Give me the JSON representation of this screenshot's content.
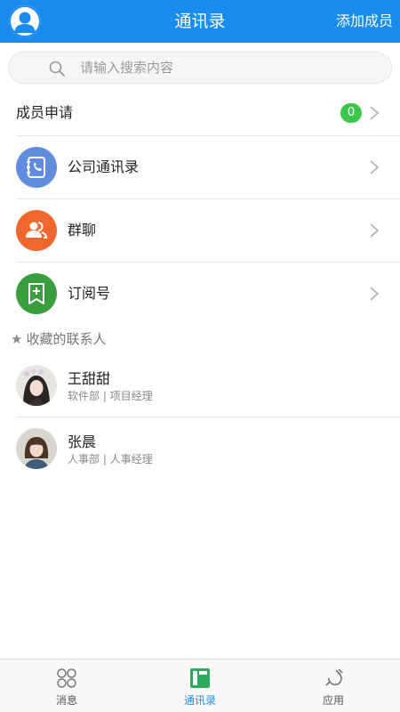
{
  "header": {
    "title": "通讯录",
    "add_member_label": "添加成员"
  },
  "search": {
    "placeholder": "请输入搜索内容"
  },
  "member_request": {
    "label": "成员申请",
    "count": "0"
  },
  "menu": [
    {
      "label": "公司通讯录",
      "icon": "address-book-icon",
      "color": "#5f8cdc"
    },
    {
      "label": "群聊",
      "icon": "group-chat-icon",
      "color": "#f0672e"
    },
    {
      "label": "订阅号",
      "icon": "subscription-icon",
      "color": "#3a9e3f"
    }
  ],
  "favorites": {
    "title": "收藏的联系人",
    "contacts": [
      {
        "name": "王甜甜",
        "dept": "软件部 | 项目经理"
      },
      {
        "name": "张晨",
        "dept": "人事部 | 人事经理"
      }
    ]
  },
  "bottom_nav": [
    {
      "label": "消息",
      "icon": "message-icon"
    },
    {
      "label": "通讯录",
      "icon": "contacts-icon",
      "active": true
    },
    {
      "label": "应用",
      "icon": "apps-icon"
    }
  ],
  "colors": {
    "brand": "#1a8cf0",
    "badge": "#3bc74a"
  }
}
